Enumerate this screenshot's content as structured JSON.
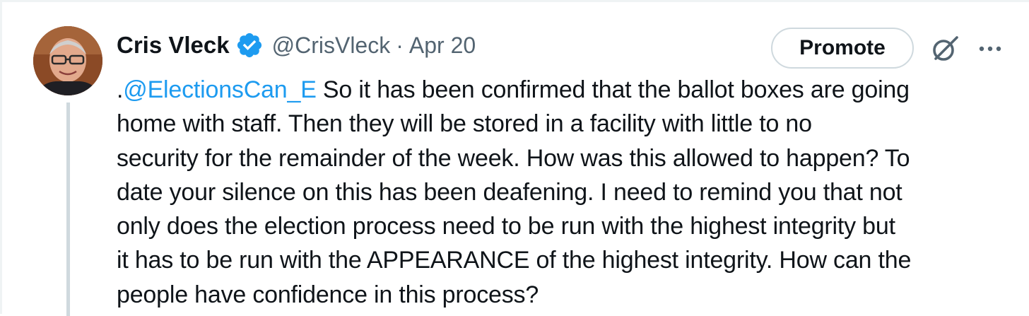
{
  "tweet": {
    "author": {
      "display_name": "Cris Vleck",
      "handle": "@CrisVleck",
      "verified": true,
      "avatar_icon": "profile-photo"
    },
    "separator": "·",
    "date": "Apr 20",
    "promote_label": "Promote",
    "actions": {
      "grok_icon": "grok-icon",
      "more_icon": "more-icon"
    },
    "text": {
      "prefix": ".",
      "mention": "@ElectionsCan_E",
      "line1_rest": " So it has been confirmed that the ballot boxes are going",
      "line2": "home with staff. Then they will be stored in a facility with little to no",
      "line3": "security for the remainder of the week. How was this allowed to happen? To",
      "line4": "date your silence on this has been deafening. I need to remind you that not",
      "line5": "only does the election process need to be run with the highest integrity but",
      "line6": "it has to be run with the APPEARANCE of the highest integrity. How can the",
      "line7": "people have confidence in this process?"
    },
    "colors": {
      "text": "#0f1419",
      "secondary": "#536471",
      "mention": "#1d9bf0",
      "verified": "#1d9bf0",
      "border": "#cfd9de"
    }
  }
}
